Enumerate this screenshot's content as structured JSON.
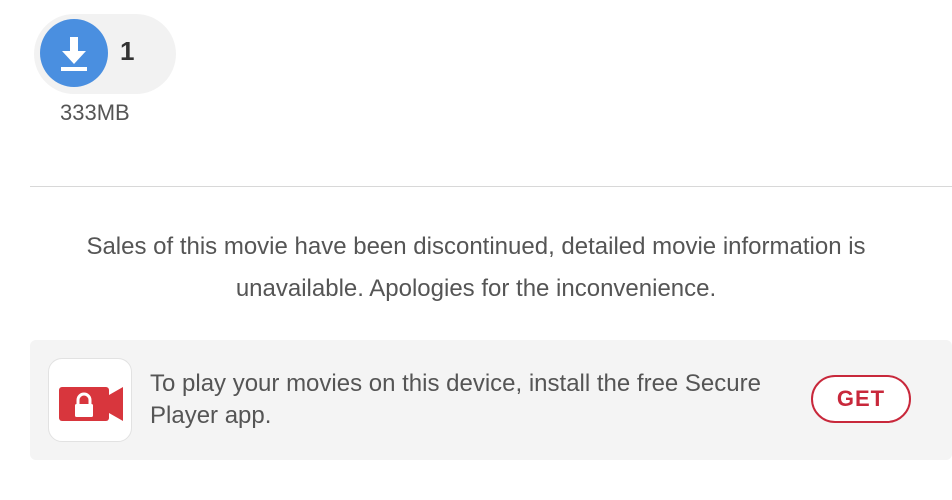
{
  "download": {
    "count": "1",
    "size": "333MB",
    "icon": "download-arrow-icon",
    "color": "#4a8fe0"
  },
  "notice": {
    "text": "Sales of this movie have been discontinued, detailed movie information is unavailable. Apologies for the inconvenience."
  },
  "promo": {
    "text": "To play your movies on this device, install the free Secure Player app.",
    "button_label": "GET",
    "app_icon": "video-camera-lock-icon",
    "accent_color": "#c8283b"
  }
}
